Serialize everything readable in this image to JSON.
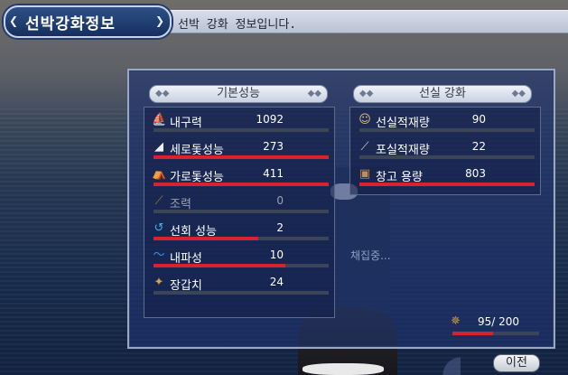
{
  "title": {
    "badge": "선박강화정보",
    "description": "선박 강화 정보입니다."
  },
  "left_column": {
    "header": "기본성능",
    "rows": [
      {
        "label": "내구력",
        "value": "1092",
        "icon": "hull-shield-icon",
        "bar_fill": 0,
        "dim": false
      },
      {
        "label": "세로돛성능",
        "value": "273",
        "icon": "lateen-sail-icon",
        "bar_fill": 1.0,
        "dim": false
      },
      {
        "label": "가로돛성능",
        "value": "411",
        "icon": "square-sail-icon",
        "bar_fill": 1.0,
        "dim": false
      },
      {
        "label": "조력",
        "value": "0",
        "icon": "oar-icon",
        "bar_fill": 0,
        "dim": true
      },
      {
        "label": "선회 성능",
        "value": "2",
        "icon": "turn-arrow-icon",
        "bar_fill": 0.6,
        "dim": false
      },
      {
        "label": "내파성",
        "value": "10",
        "icon": "wave-icon",
        "bar_fill": 0.75,
        "dim": false
      },
      {
        "label": "장갑치",
        "value": "24",
        "icon": "armor-plate-icon",
        "bar_fill": 0,
        "dim": false
      }
    ]
  },
  "right_column": {
    "header": "선실 강화",
    "rows": [
      {
        "label": "선실적재량",
        "value": "90",
        "icon": "sailor-icon",
        "bar_fill": 0
      },
      {
        "label": "포실적재량",
        "value": "22",
        "icon": "cannon-icon",
        "bar_fill": 0
      },
      {
        "label": "창고 용량",
        "value": "803",
        "icon": "cargo-sack-icon",
        "bar_fill": 1.0
      }
    ]
  },
  "ghost_text": "채집중...",
  "food": {
    "icon": "ship-wheel-icon",
    "value": "95/ 200",
    "bar_fill": 0.47
  },
  "buttons": {
    "prev_label": "이전"
  },
  "colors": {
    "bar_fill": "#d52430",
    "panel": "#1e326e",
    "header_text": "#333a4a"
  }
}
